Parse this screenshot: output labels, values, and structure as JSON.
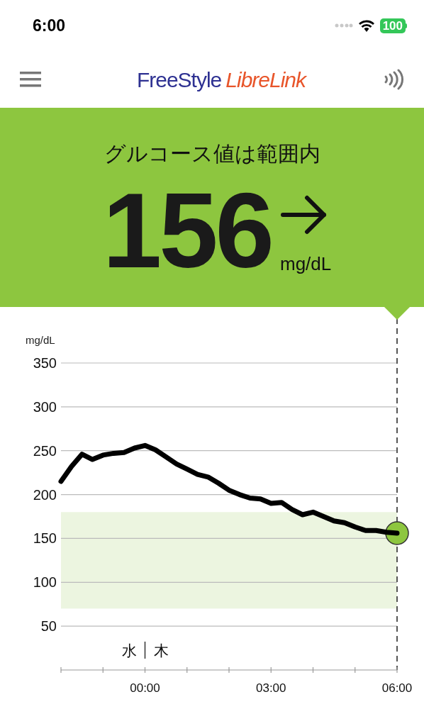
{
  "status_bar": {
    "time": "6:00",
    "battery": "100"
  },
  "header": {
    "logo_primary": "FreeStyle",
    "logo_secondary": "LibreLink"
  },
  "reading": {
    "status": "グルコース値は範囲内",
    "value": "156",
    "unit": "mg/dL"
  },
  "day_labels": [
    "水",
    "木"
  ],
  "chart": {
    "chart_data": {
      "type": "line",
      "ylabel": "mg/dL",
      "x": [
        -2,
        -1.75,
        -1.5,
        -1.25,
        -1,
        -0.75,
        -0.5,
        -0.25,
        0,
        0.25,
        0.5,
        0.75,
        1,
        1.25,
        1.5,
        1.75,
        2,
        2.25,
        2.5,
        2.75,
        3,
        3.25,
        3.5,
        3.75,
        4,
        4.25,
        4.5,
        4.75,
        5,
        5.25,
        5.5,
        5.75,
        6
      ],
      "series": [
        {
          "color": "#000000",
          "values": [
            215,
            232,
            246,
            240,
            245,
            247,
            248,
            253,
            256,
            251,
            243,
            235,
            229,
            223,
            220,
            213,
            205,
            200,
            196,
            195,
            190,
            191,
            183,
            177,
            180,
            175,
            170,
            168,
            163,
            159,
            159,
            157,
            156
          ]
        }
      ],
      "xlim": [
        -2,
        6
      ],
      "ylim": [
        0,
        350
      ],
      "xticks": [
        {
          "value": 0,
          "label": "00:00"
        },
        {
          "value": 3,
          "label": "03:00"
        },
        {
          "value": 6,
          "label": "06:00"
        }
      ],
      "yticks": [
        50,
        100,
        150,
        200,
        250,
        300,
        350
      ],
      "grid": true,
      "bands": [
        {
          "axis": "y",
          "from": 70,
          "to": 180,
          "color": "#ecf5e0"
        }
      ]
    }
  }
}
